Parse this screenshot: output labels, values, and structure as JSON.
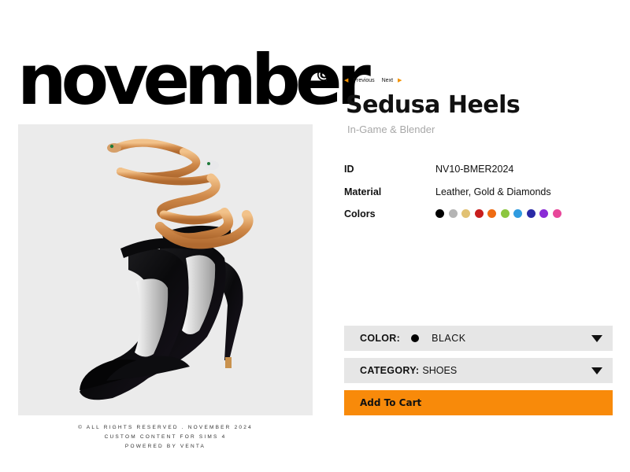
{
  "brand": {
    "logo_text": "november",
    "logo_mark": "©"
  },
  "footer": {
    "line1": "© ALL RIGHTS RESERVED . NOVEMBER 2024",
    "line2": "CUSTOM CONTENT FOR SIMS 4",
    "line3": "POWERED BY VENTA"
  },
  "pager": {
    "previous": "Previous",
    "next": "Next",
    "arrow_color": "#f39200"
  },
  "product": {
    "name": "Sedusa Heels",
    "subtitle": "In-Game & Blender",
    "image_icon": "snake-heels-illustration",
    "specs": {
      "id_label": "ID",
      "id_value": "NV10-BMER2024",
      "material_label": "Material",
      "material_value": "Leather, Gold & Diamonds",
      "colors_label": "Colors"
    },
    "color_swatches": [
      "#000000",
      "#b4b4b4",
      "#e1c173",
      "#c81e1e",
      "#ef6b12",
      "#8cc63f",
      "#2f9be0",
      "#2a2aa6",
      "#8a2bd6",
      "#e8479a"
    ]
  },
  "color_select": {
    "label": "COLOR:",
    "selected": "BLACK",
    "selected_color": "#000000"
  },
  "category_select": {
    "label": "CATEGORY:",
    "selected": "SHOES"
  },
  "cart": {
    "button_label": "Add To Cart",
    "accent": "#f88a0a"
  }
}
